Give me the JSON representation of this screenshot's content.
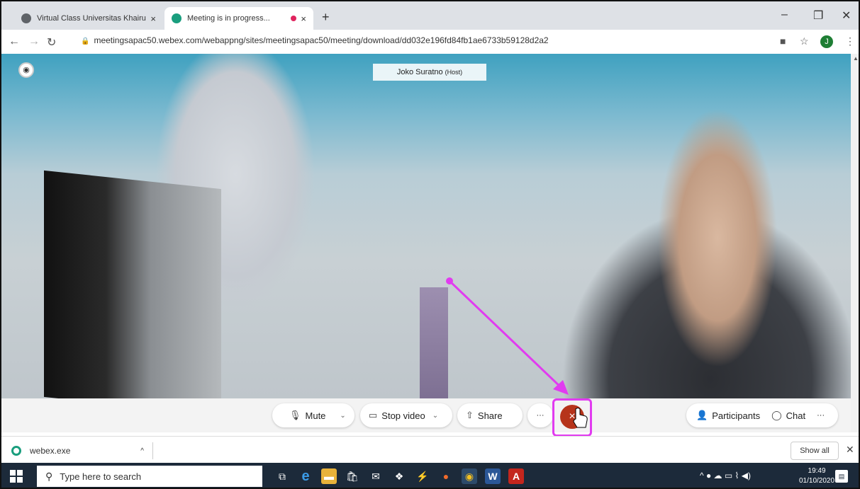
{
  "browser": {
    "tabs": [
      {
        "title": "Virtual Class Universitas Khairun",
        "close": "×"
      },
      {
        "title": "Meeting is in progress...",
        "close": "×"
      }
    ],
    "new_tab": "+",
    "url": "meetingsapac50.webex.com/webappng/sites/meetingsapac50/meeting/download/dd032e196fd84fb1ae6733b59128d2a2",
    "profile_initial": "J"
  },
  "meeting": {
    "host_name": "Joko Suratno",
    "host_role": "(Host)",
    "controls": {
      "mute": "Mute",
      "stop_video": "Stop video",
      "share": "Share",
      "more": "···",
      "participants": "Participants",
      "chat": "Chat",
      "end_icon": "×"
    }
  },
  "downloads": {
    "file_name": "webex.exe",
    "show_all": "Show all"
  },
  "taskbar": {
    "search_placeholder": "Type here to search",
    "time": "19:49",
    "date": "01/10/2020"
  },
  "colors": {
    "end_button": "#b6341b",
    "highlight": "#e13bf0",
    "annotation_arrow": "#e13bf0"
  }
}
